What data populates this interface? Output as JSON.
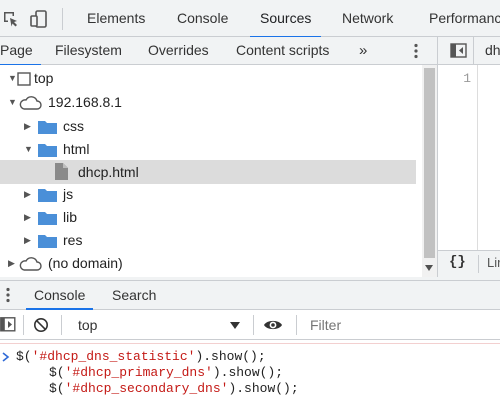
{
  "toolbar": {
    "tabs": [
      {
        "label": "Elements",
        "active": false
      },
      {
        "label": "Console",
        "active": false
      },
      {
        "label": "Sources",
        "active": true
      },
      {
        "label": "Network",
        "active": false
      },
      {
        "label": "Performance",
        "active": false
      }
    ]
  },
  "navigator": {
    "tabs": [
      "Page",
      "Filesystem",
      "Overrides",
      "Content scripts"
    ],
    "more": "»"
  },
  "tree": {
    "top": "top",
    "host": "192.168.8.1",
    "folders": [
      "css",
      "html",
      "js",
      "lib",
      "res"
    ],
    "selected_file": "dhcp.html",
    "no_domain": "(no domain)"
  },
  "editor": {
    "tab_label": "dhc",
    "line_number": "1",
    "footer_text": "Lir",
    "format_icon": "{}"
  },
  "drawer": {
    "tabs": [
      "Console",
      "Search"
    ],
    "context": "top",
    "filter_placeholder": "Filter"
  },
  "console": {
    "lines": [
      {
        "prefix": "$(",
        "arg": "'#dhcp_dns_statistic'",
        "suffix": ").show();"
      },
      {
        "prefix": "$(",
        "arg": "'#dhcp_primary_dns'",
        "suffix": ").show();"
      },
      {
        "prefix": "$(",
        "arg": "'#dhcp_secondary_dns'",
        "suffix": ").show();"
      }
    ]
  },
  "colors": {
    "accent": "#1a73e8",
    "folder": "#4a8fd8",
    "string": "#c41a16",
    "prompt": "#2f6ad7"
  }
}
